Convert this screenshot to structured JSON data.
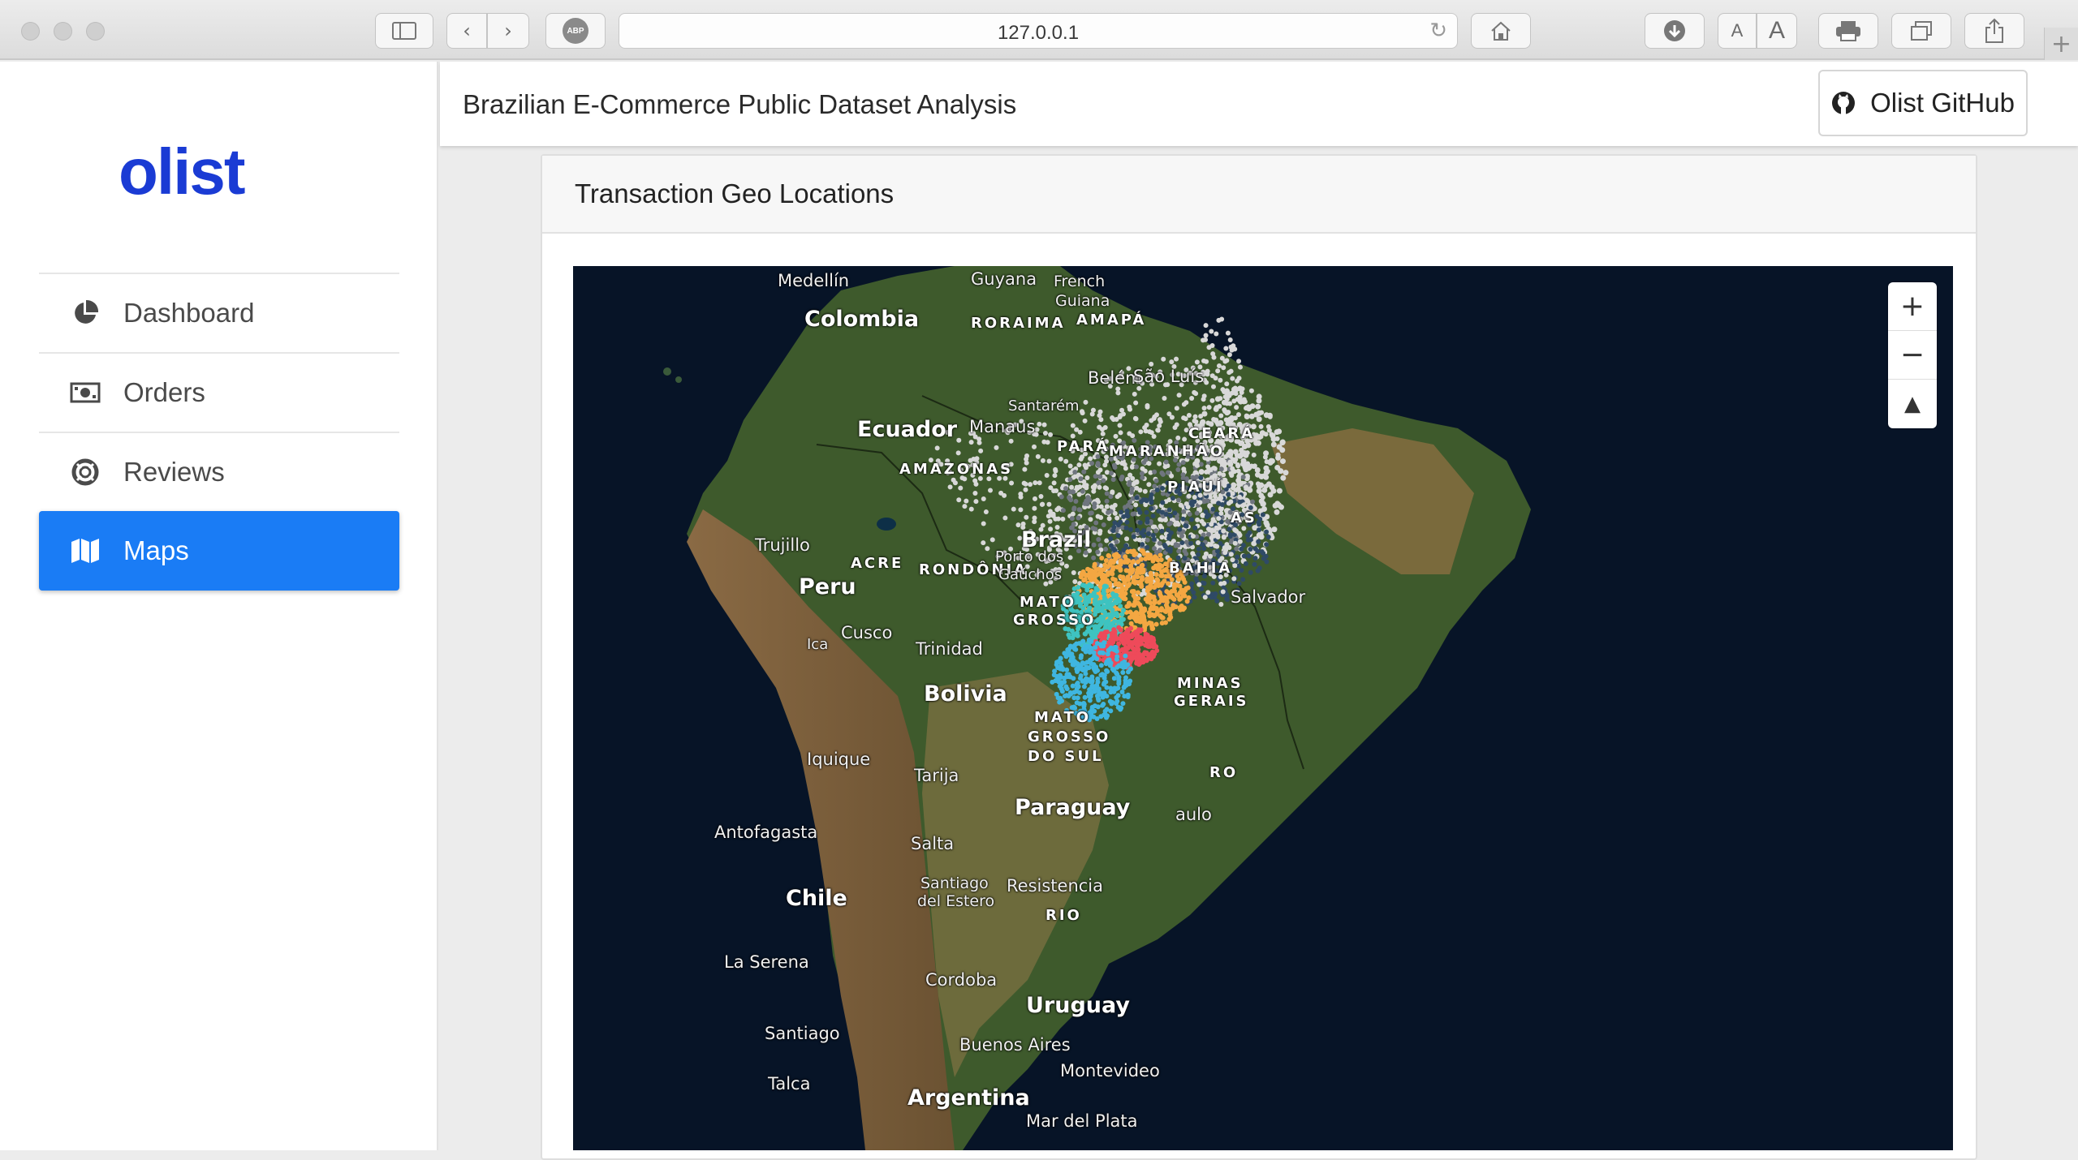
{
  "browser": {
    "url": "127.0.0.1",
    "adblock_label": "ABP",
    "text_small": "A",
    "text_large": "A"
  },
  "sidebar": {
    "logo": "olist",
    "items": [
      {
        "label": "Dashboard",
        "icon": "pie-chart-icon",
        "active": false
      },
      {
        "label": "Orders",
        "icon": "money-icon",
        "active": false
      },
      {
        "label": "Reviews",
        "icon": "life-ring-icon",
        "active": false
      },
      {
        "label": "Maps",
        "icon": "map-icon",
        "active": true
      }
    ]
  },
  "header": {
    "title": "Brazilian E-Commerce Public Dataset Analysis",
    "github_label": "Olist GitHub"
  },
  "card": {
    "title": "Transaction Geo Locations"
  },
  "map": {
    "zoom_in": "+",
    "zoom_out": "−",
    "compass": "▲",
    "colors": {
      "ocean": "#071427",
      "land": "#3e5a2c",
      "white_points": "#d8d8d8",
      "gray_points": "#6f757e",
      "navy_points": "#2f4a66",
      "orange_points": "#f4a742",
      "teal_points": "#3ec3c0",
      "red_points": "#ee4a5a",
      "blue_points": "#3fb6e0"
    },
    "labels": {
      "medellin": "Medellín",
      "guyana": "Guyana",
      "french_guiana_1": "French",
      "french_guiana_2": "Guiana",
      "colombia": "Colombia",
      "roraima": "RORAIMA",
      "amapa": "AMAPÁ",
      "belem": "Belém",
      "sao_luis": "São Luís",
      "santarem": "Santarém",
      "manaus": "Manaus",
      "ecuador": "Ecuador",
      "para": "PARÁ",
      "maranhao": "MARANHÃO",
      "ceara": "CEARÁ",
      "amazonas": "AMAZONAS",
      "piaui": "PIAUÍ",
      "alagoas": "AS",
      "trujillo": "Trujillo",
      "brazil": "Brazil",
      "acre": "ACRE",
      "rondonia": "RONDÔNIA",
      "porto_gauchos_1": "Porto dos",
      "porto_gauchos_2": "Gaúchos",
      "bahia": "BAHIA",
      "salvador": "Salvador",
      "peru": "Peru",
      "mato_grosso_1": "MATO",
      "mato_grosso_2": "GROSSO",
      "cusco": "Cusco",
      "ica": "Ica",
      "trinidad": "Trinidad",
      "bolivia": "Bolivia",
      "minas": "MINAS",
      "gerais": "GERAIS",
      "ms_1": "MATO",
      "ms_2": "GROSSO",
      "ms_3": "DO SUL",
      "iquique": "Iquique",
      "tarija": "Tarija",
      "rio": "RO",
      "paraguay": "Paraguay",
      "sao_paulo": "aulo",
      "antofagasta": "Antofagasta",
      "salta": "Salta",
      "santiago_estero_1": "Santiago",
      "santiago_estero_2": "del Estero",
      "resistencia": "Resistencia",
      "chile": "Chile",
      "rio_grande": "RIO",
      "la_serena": "La Serena",
      "cordoba": "Cordoba",
      "uruguay": "Uruguay",
      "santiago": "Santiago",
      "buenos_aires": "Buenos Aires",
      "montevideo": "Montevideo",
      "talca": "Talca",
      "argentina": "Argentina",
      "mar_del_plata": "Mar del Plata"
    }
  }
}
